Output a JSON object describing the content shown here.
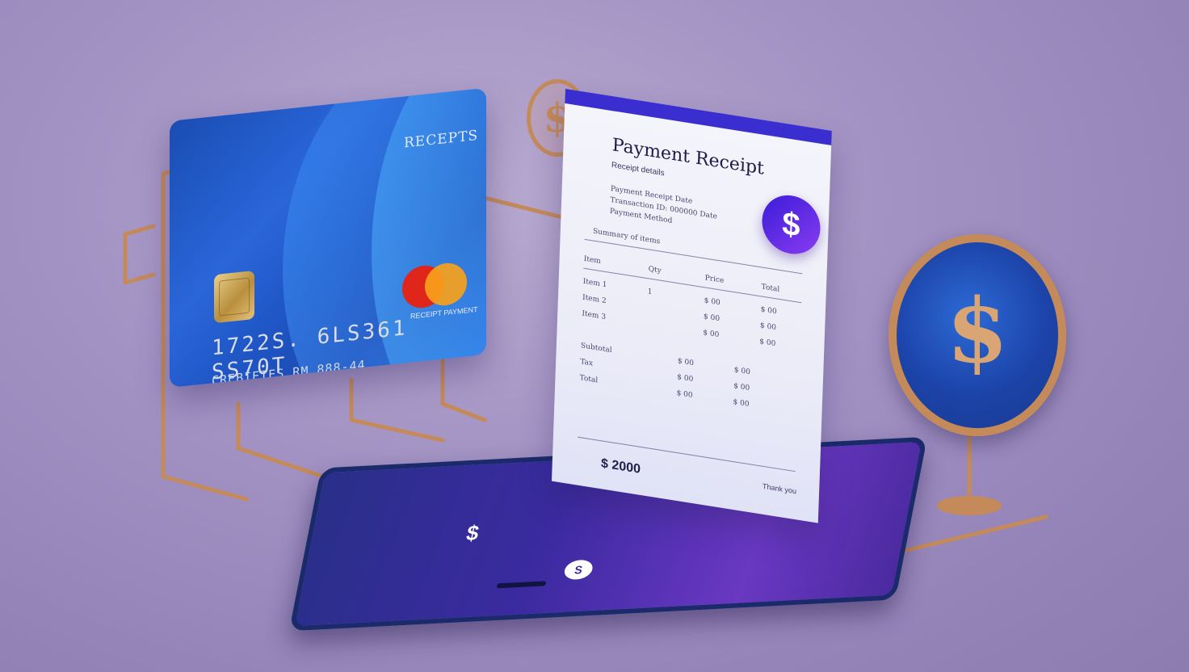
{
  "card": {
    "brand_label": "RECEPTS",
    "number": "1722S. 6LS361 SS70T",
    "holder": "CREBIETES RM 888-44",
    "network_text": "RECEIPT PAYMENT",
    "colors": {
      "primary": "#1f55c4",
      "chip": "#d9b46a",
      "mc_red": "#e0261b",
      "mc_yellow": "#f7a11b"
    }
  },
  "receipt": {
    "title": "Payment Receipt",
    "subtitle": "Receipt details",
    "header_lines": [
      "Payment Receipt Date",
      "Transaction ID: 000000 Date",
      "Payment Method"
    ],
    "section_label": "Summary of items",
    "columns": [
      "Item",
      "Qty",
      "Price",
      "Total"
    ],
    "rows": [
      [
        "Item 1",
        "1",
        "$ 00",
        "$ 00"
      ],
      [
        "Item 2",
        "",
        "$ 00",
        "$ 00"
      ],
      [
        "Item 3",
        "",
        "$ 00",
        "$ 00"
      ],
      [
        "Subtotal",
        "",
        "$ 00",
        "$ 00"
      ],
      [
        "Tax",
        "",
        "$ 00",
        "$ 00"
      ],
      [
        "Total",
        "",
        "$ 00",
        "$ 00"
      ]
    ],
    "total_label": "$ 2000",
    "footer": "Thank you",
    "badge_symbol": "$",
    "accent": "#3b2ed0"
  },
  "phone": {
    "screen_symbol": "$",
    "badge_symbol": "S",
    "accent": "#6a38c2"
  },
  "sign": {
    "symbol": "$",
    "face_color": "#1c43a8",
    "rim_color": "#c58a5a"
  },
  "coin": {
    "symbol": "$",
    "color": "#c58a5a"
  }
}
